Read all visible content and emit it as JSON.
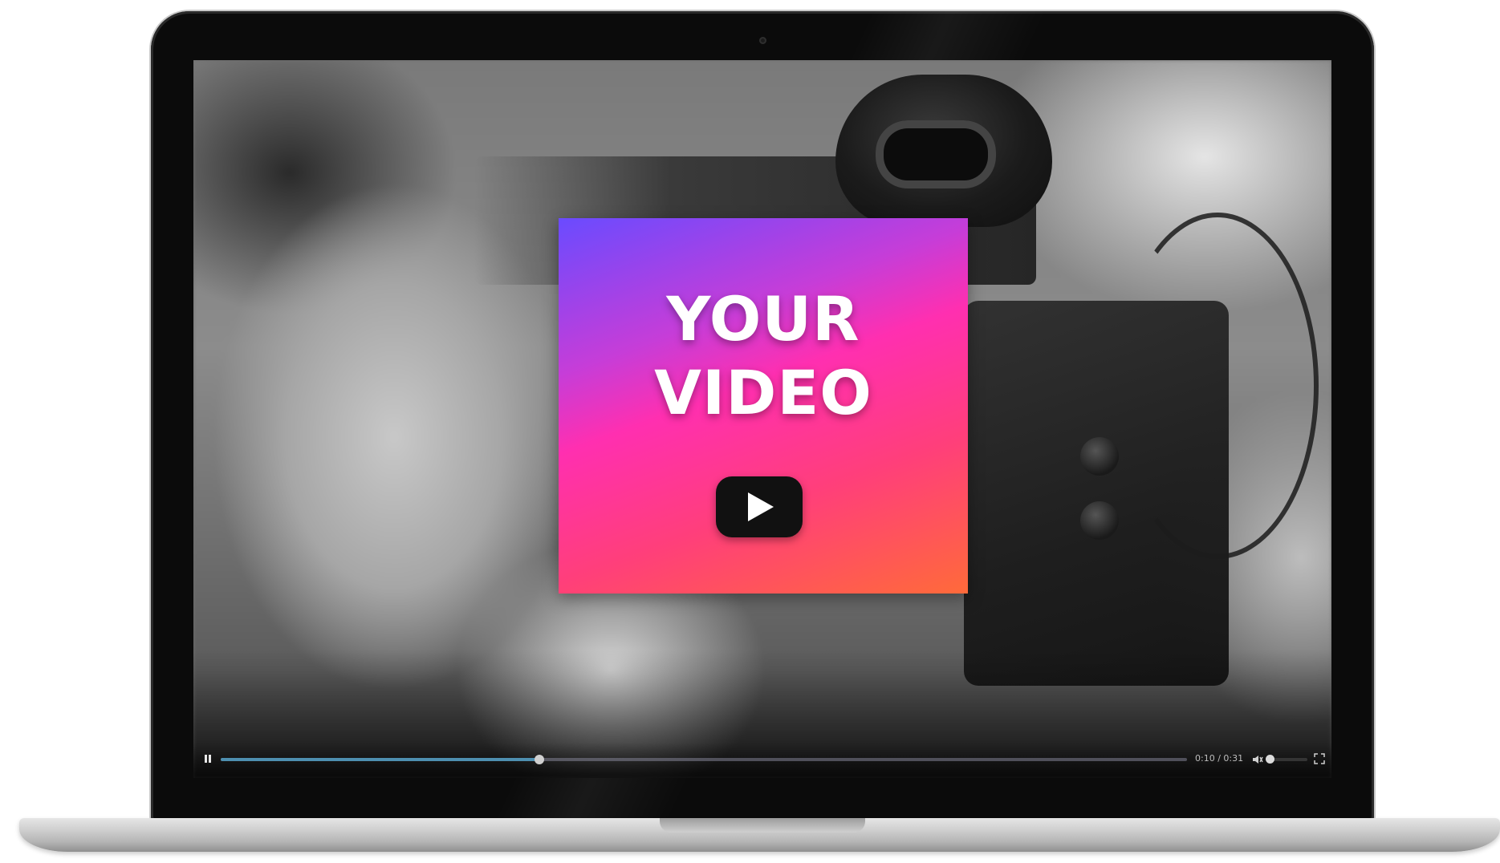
{
  "thumbnail": {
    "title": "YOUR\nVIDEO",
    "gradient_colors": [
      "#6a4bff",
      "#ff2fb0",
      "#ff6a3a"
    ],
    "play_icon": "play-icon"
  },
  "player": {
    "time_display": "0:10 / 0:31",
    "progress_fraction": 0.33,
    "volume_fraction": 0.0,
    "icons": [
      "pause-icon",
      "volume-icon",
      "fullscreen-icon"
    ]
  }
}
